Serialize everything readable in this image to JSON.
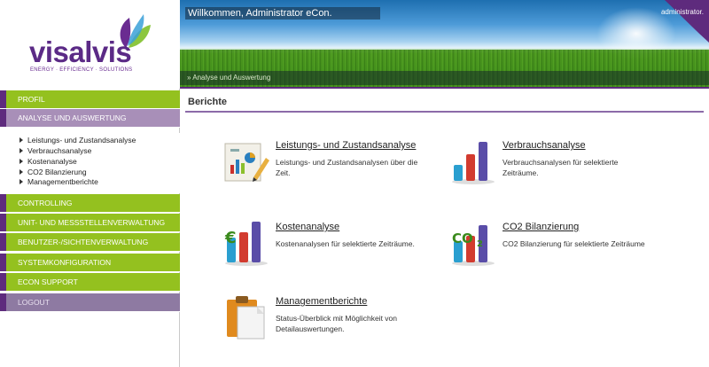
{
  "brand": {
    "name": "visalvis",
    "tagline": "ENERGY · EFFICIENCY · SOLUTIONS",
    "colors": {
      "purple": "#5e2b7d",
      "green": "#94c11f",
      "active": "#a88fb8"
    }
  },
  "header": {
    "welcome": "Willkommen, Administrator eCon.",
    "user": "administrator.",
    "breadcrumb": "» Analyse und Auswertung"
  },
  "sidebar": {
    "items": [
      {
        "label": "PROFIL",
        "style": "green"
      },
      {
        "label": "ANALYSE UND AUSWERTUNG",
        "style": "active"
      },
      {
        "label": "CONTROLLING",
        "style": "green"
      },
      {
        "label": "UNIT- UND MESSSTELLENVERWALTUNG",
        "style": "green"
      },
      {
        "label": "BENUTZER-/SICHTENVERWALTUNG",
        "style": "green"
      },
      {
        "label": "SYSTEMKONFIGURATION",
        "style": "green"
      },
      {
        "label": "ECON SUPPORT",
        "style": "green"
      },
      {
        "label": "LOGOUT",
        "style": "purple"
      }
    ],
    "subitems": [
      "Leistungs- und Zustandsanalyse",
      "Verbrauchsanalyse",
      "Kostenanalyse",
      "CO2 Bilanzierung",
      "Managementberichte"
    ]
  },
  "main": {
    "title": "Berichte",
    "cards": [
      {
        "title": "Leistungs- und Zustandsanalyse",
        "desc": "Leistungs- und Zustandsanalysen über die Zeit.",
        "icon": "report-pencil-icon"
      },
      {
        "title": "Verbrauchsanalyse",
        "desc": "Verbrauchsanalysen für selektierte Zeiträume.",
        "icon": "bar-chart-icon"
      },
      {
        "title": "Kostenanalyse",
        "desc": "Kostenanalysen für selektierte Zeiträume.",
        "icon": "euro-chart-icon"
      },
      {
        "title": "CO2 Bilanzierung",
        "desc": "CO2 Bilanzierung für selektierte Zeiträume",
        "icon": "co2-chart-icon"
      },
      {
        "title": "Managementberichte",
        "desc": "Status-Überblick mit Möglichkeit von Detailauswertungen.",
        "icon": "clipboard-icon"
      }
    ]
  }
}
